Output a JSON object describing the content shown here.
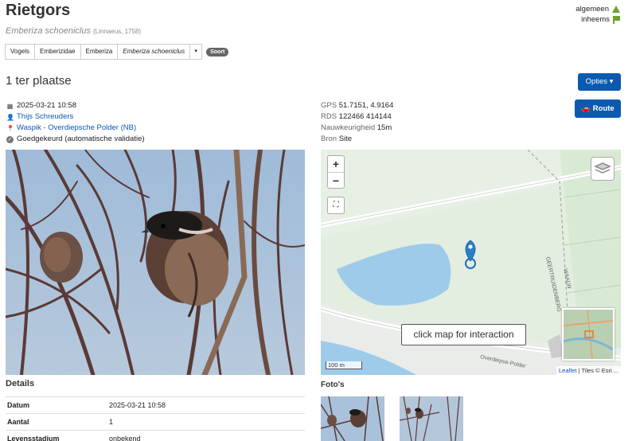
{
  "species": {
    "name": "Rietgors",
    "scientific": "Emberiza schoeniclus",
    "authority": "(Linnaeus, 1758)"
  },
  "status": {
    "items": [
      {
        "label": "algemeen",
        "icon": "triangle-up-icon"
      },
      {
        "label": "inheems",
        "icon": "flag-icon"
      }
    ],
    "color": "#6aa532"
  },
  "breadcrumb": {
    "items": [
      "Vogels",
      "Emberizidae",
      "Emberiza",
      "Emberiza schoeniclus"
    ],
    "dropdown": "▾",
    "badge": "Soort"
  },
  "observation": {
    "heading": "1 ter plaatse",
    "datetime": "2025-03-21 10:58",
    "observer": "Thijs Schreuders",
    "location": "Waspik - Overdiepsche Polder (NB)",
    "validation": "Goedgekeurd (automatische validatie)"
  },
  "geo": {
    "gps_label": "GPS",
    "gps_value": "51.7151, 4.9164",
    "rds_label": "RDS",
    "rds_value": "122466 414144",
    "accuracy_label": "Nauwkeurigheid",
    "accuracy_value": "15m",
    "source_label": "Bron",
    "source_value": "Site"
  },
  "buttons": {
    "options": "Opties ▾",
    "route": "Route",
    "accent": "#0b5ab0"
  },
  "map": {
    "zoom_in": "+",
    "zoom_out": "−",
    "fullscreen": "⛶",
    "overlay_text": "click map for interaction",
    "scale": "100 m",
    "attribution_link": "Leaflet",
    "attribution_rest": " | Tiles © Esri ...",
    "road1": "Overdiepse-Polder",
    "road2": "GEERTRUIDENBERG",
    "road3": "WAALW"
  },
  "details": {
    "heading": "Details",
    "rows": [
      {
        "key": "Datum",
        "value": "2025-03-21 10:58"
      },
      {
        "key": "Aantal",
        "value": "1"
      },
      {
        "key": "Levensstadium",
        "value": "onbekend"
      }
    ]
  },
  "photos": {
    "heading": "Foto's"
  }
}
